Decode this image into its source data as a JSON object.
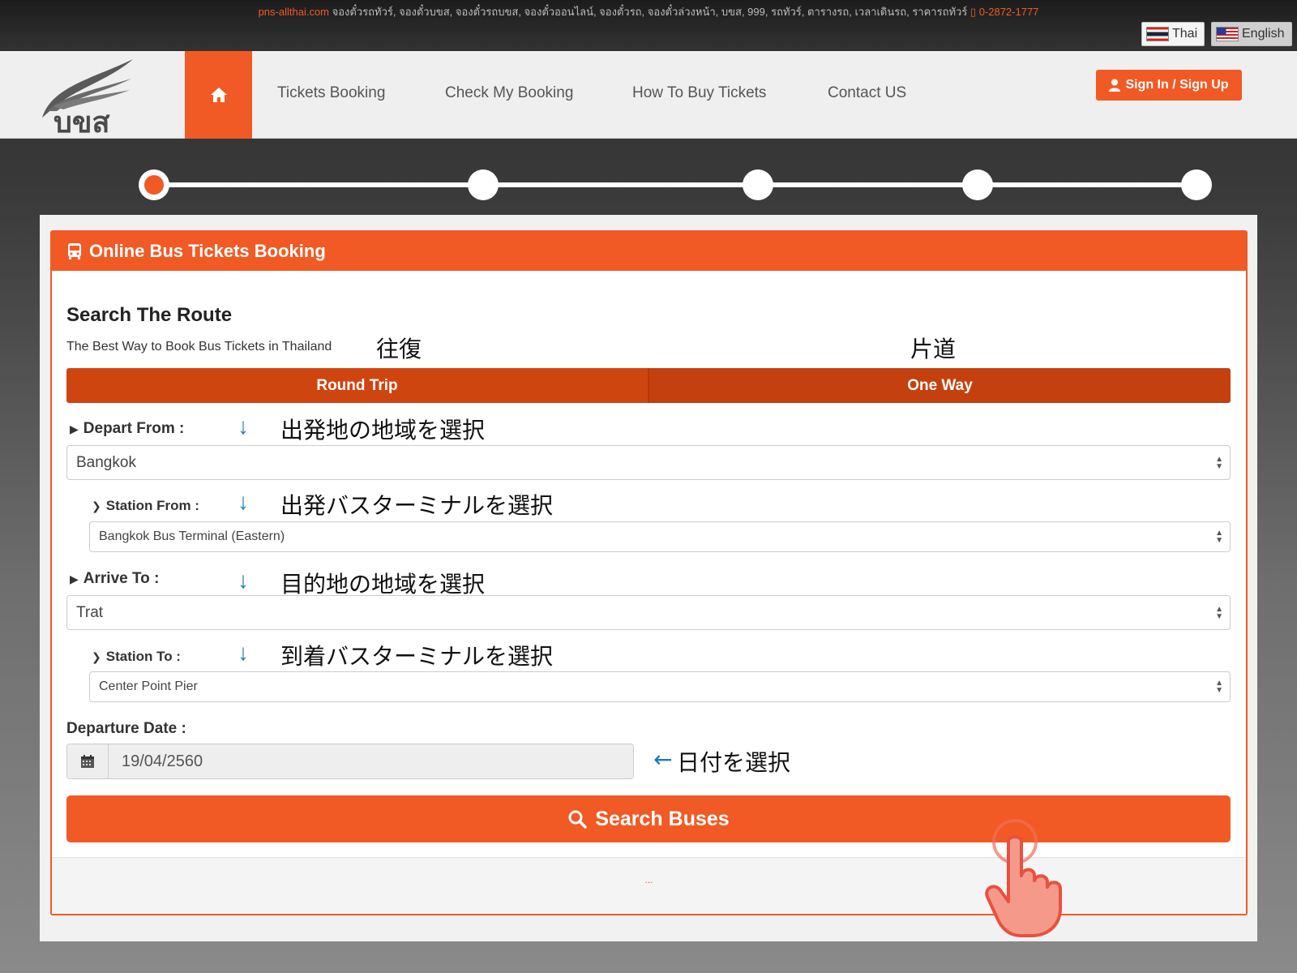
{
  "topbar": {
    "site": "pns-allthai.com",
    "keywords": " จองตั๋วรถทัวร์, จองตั๋วบขส, จองตั๋วรถบขส, จองตั๋วออนไลน์, จองตั๋วรถ, จองตั๋วล่วงหน้า, บขส, 999, รถทัวร์, ตารางรถ, เวลาเดินรถ, ราคารถทัวร์ ",
    "phone": "0-2872-1777"
  },
  "language": {
    "thai": "Thai",
    "english": "English"
  },
  "logo_text": "บขส",
  "nav": {
    "items": [
      "Tickets Booking",
      "Check My Booking",
      "How To Buy Tickets",
      "Contact US"
    ],
    "signin": "Sign In / Sign Up"
  },
  "card": {
    "header": "Online Bus Tickets Booking",
    "title": "Search The Route",
    "subtitle": "The Best Way to Book Bus Tickets in Thailand",
    "footer_dots": "..."
  },
  "trip": {
    "round": "Round Trip",
    "oneway": "One Way"
  },
  "form": {
    "depart_label": "Depart From :",
    "depart_value": "Bangkok",
    "station_from_label": "Station From :",
    "station_from_value": "Bangkok Bus Terminal (Eastern)",
    "arrive_label": "Arrive To :",
    "arrive_value": "Trat",
    "station_to_label": "Station To :",
    "station_to_value": "Center Point Pier",
    "date_label": "Departure Date :",
    "date_value": "19/04/2560",
    "search_button": "Search Buses"
  },
  "annotations": {
    "round_trip": "往復",
    "one_way": "片道",
    "depart": "出発地の地域を選択",
    "station_from": "出発バスターミナルを選択",
    "arrive": "目的地の地域を選択",
    "station_to": "到着バスターミナルを選択",
    "date": "日付を選択",
    "down_arrow": "↓",
    "left_arrow": "←"
  },
  "colors": {
    "accent": "#f15a24",
    "tab": "#cf4510",
    "arrow": "#1a7bb8"
  },
  "icons": [
    "home-icon",
    "user-icon",
    "bus-icon",
    "calendar-icon",
    "search-icon",
    "pointing-hand-icon"
  ]
}
